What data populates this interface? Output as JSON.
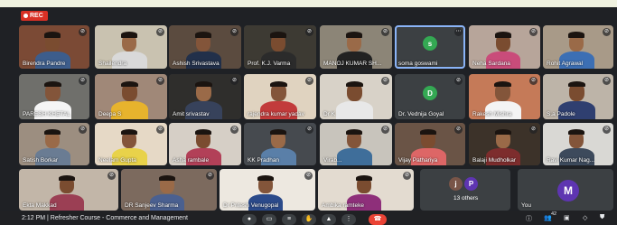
{
  "recording_label": "REC",
  "colors": {
    "accent": "#8ab4f8",
    "rec": "#d93025",
    "end_call": "#ea4335",
    "avatar_green": "#34a853",
    "avatar_purple": "#5e35b1"
  },
  "participants": [
    {
      "name": "Birendra Pandre"
    },
    {
      "name": "Shailendra"
    },
    {
      "name": "Ashish Srivastava"
    },
    {
      "name": "Prof. K.J. Varma"
    },
    {
      "name": "MANOJ KUMAR SH..."
    },
    {
      "name": "soma goswami",
      "initial": "s"
    },
    {
      "name": "Neha Sardana"
    },
    {
      "name": "Rohit Agrawal"
    },
    {
      "name": "PARESH KHETAL"
    },
    {
      "name": "Deepa S"
    },
    {
      "name": "Amit srivastav"
    },
    {
      "name": "rajendra kumar yadav"
    },
    {
      "name": "Dr K"
    },
    {
      "name": "Dr. Vednija Goyal",
      "initial": "D"
    },
    {
      "name": "Rakesh Mishra"
    },
    {
      "name": "S.a Padole"
    },
    {
      "name": "Satish Borkar"
    },
    {
      "name": "Neelam Gupta"
    },
    {
      "name": "Asha rambale"
    },
    {
      "name": "KK Pradhan"
    },
    {
      "name": "Virab..."
    },
    {
      "name": "Vijay Pathariya"
    },
    {
      "name": "Balaji Mudholkar"
    },
    {
      "name": "Ravi Kumar Nag..."
    },
    {
      "name": "Ekta Makkad"
    },
    {
      "name": "DR Sanjeev Sharma"
    },
    {
      "name": "Dr Pritesh Venugopal"
    },
    {
      "name": "Ambika ramteke"
    }
  ],
  "others_tile": {
    "initials": [
      "j",
      "P"
    ],
    "label": "13 others"
  },
  "self_tile": {
    "initial": "M",
    "label": "You"
  },
  "bottom": {
    "time": "2:12 PM",
    "meeting_title": "Refresher Course - Commerce and Management",
    "participant_count": "42"
  },
  "icons": {
    "mic": "mic-icon",
    "cam": "camera-icon",
    "cc": "captions-icon",
    "hand": "raise-hand-icon",
    "present": "present-icon",
    "more": "more-icon",
    "end": "end-call-icon",
    "info": "info-icon",
    "people": "people-icon",
    "chat": "chat-icon"
  }
}
